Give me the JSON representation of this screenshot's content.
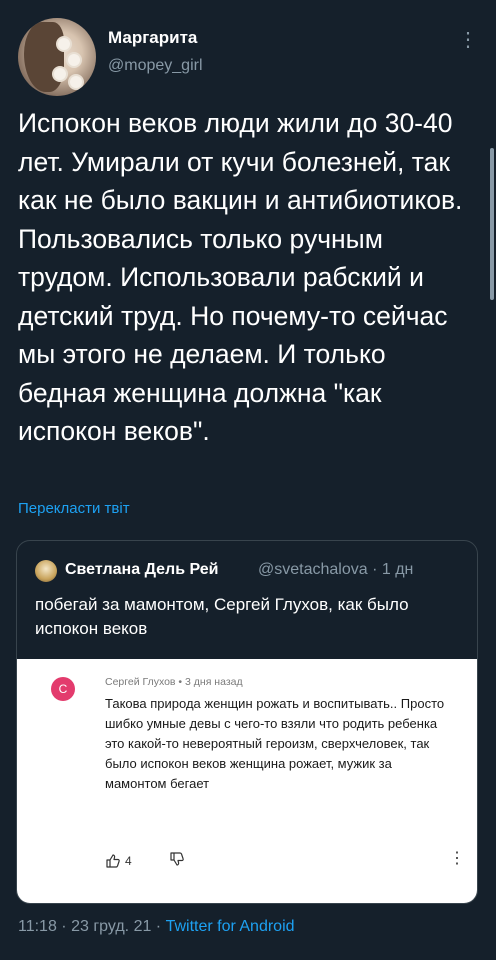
{
  "author": {
    "name": "Маргарита",
    "handle": "@mopey_girl"
  },
  "tweet": {
    "text": "Испокон веков люди жили до 30-40 лет. Умирали от кучи болезней, так как не было вакцин и антибиотиков. Пользовались только ручным трудом. Использовали рабский и детский труд. Но почему-то сейчас мы этого не делаем. И только бедная женщина должна \"как испокон веков\".",
    "translate_label": "Перекласти твіт"
  },
  "quote": {
    "name": "Светлана Дель Рей",
    "handle_time": "@svetachalova · 1 дн",
    "text": "побегай за мамонтом, Сергей Глухов, как было испокон веков",
    "comment": {
      "avatar_letter": "С",
      "meta": "Сергей Глухов • 3 дня назад",
      "text": "Такова природа женщин рожать и воспитывать.. Просто шибко умные девы с чего-то взяли что родить ребенка это какой-то невероятный героизм, сверхчеловек, так было испокон веков женщина рожает, мужик за мамонтом бегает",
      "likes": "4",
      "colors": {
        "avatar": "#e33b6d"
      }
    }
  },
  "footer": {
    "timestamp": "11:18 · 23 груд. 21 · ",
    "source": "Twitter for Android"
  },
  "colors": {
    "background": "#15202b",
    "link": "#1da1f2",
    "secondary_text": "#8899a6",
    "border": "#38444d"
  },
  "icons": {
    "more": "more-vertical-icon",
    "like": "thumbs-up-icon",
    "dislike": "thumbs-down-icon"
  }
}
